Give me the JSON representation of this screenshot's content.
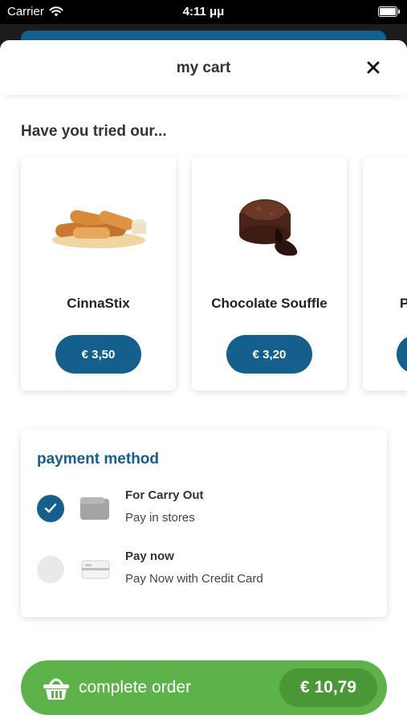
{
  "status_bar": {
    "carrier": "Carrier",
    "time": "4:11 μμ"
  },
  "sheet": {
    "title": "my cart"
  },
  "upsell": {
    "heading": "Have you tried our...",
    "items": [
      {
        "name": "CinnaStix",
        "price": "€ 3,50"
      },
      {
        "name": "Chocolate Souffle",
        "price": "€ 3,20"
      },
      {
        "name": "P",
        "price": ""
      }
    ]
  },
  "payment": {
    "heading": "payment method",
    "options": [
      {
        "title": "For Carry Out",
        "subtitle": "Pay in stores",
        "selected": true,
        "icon": "wallet-icon"
      },
      {
        "title": "Pay now",
        "subtitle": "Pay Now with Credit Card",
        "selected": false,
        "icon": "credit-card-icon"
      }
    ]
  },
  "order": {
    "label": "complete order",
    "total": "€ 10,79"
  },
  "colors": {
    "brand_blue": "#145f8c",
    "order_green": "#5db349",
    "total_green": "#4a9738"
  }
}
